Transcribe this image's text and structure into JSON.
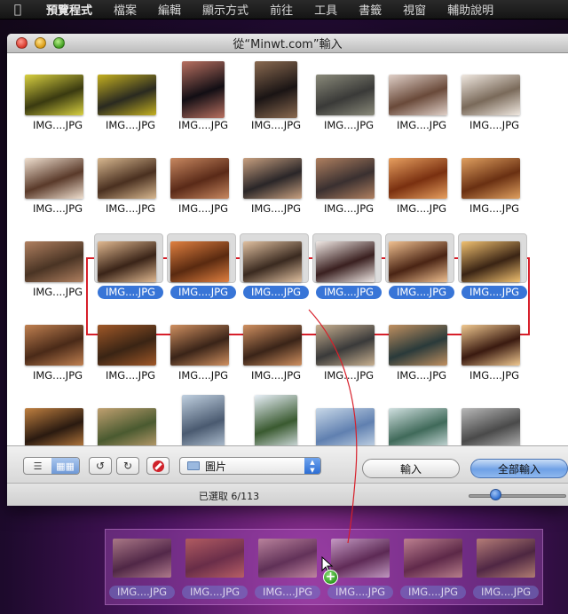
{
  "menubar": {
    "apple": "",
    "items": [
      "預覽程式",
      "檔案",
      "編輯",
      "顯示方式",
      "前往",
      "工具",
      "書籤",
      "視窗",
      "輔助說明"
    ]
  },
  "window": {
    "title": "從“Minwt.com”輸入"
  },
  "thumbnails": {
    "label": "IMG....JPG",
    "rows": [
      {
        "y": 0,
        "colors": [
          [
            "#3a3a10",
            "#d8d040"
          ],
          [
            "#2a2a20",
            "#c4b020"
          ],
          [
            "#120e14",
            "#b87060"
          ],
          [
            "#1a1414",
            "#8a6a50"
          ],
          [
            "#3a3a38",
            "#8a8a7a"
          ],
          [
            "#6a4a3a",
            "#e0d0c8"
          ],
          [
            "#7a6a5a",
            "#f0e8e0"
          ]
        ]
      },
      {
        "y": 1,
        "colors": [
          [
            "#5a3a2a",
            "#f0e0d0"
          ],
          [
            "#4a3020",
            "#d8b890"
          ],
          [
            "#5a2a18",
            "#c88860"
          ],
          [
            "#2a2628",
            "#c8a080"
          ],
          [
            "#3a3030",
            "#b08060"
          ],
          [
            "#7a3010",
            "#e8a060"
          ],
          [
            "#6a3012",
            "#e0a060"
          ]
        ]
      },
      {
        "y": 2,
        "colors": [
          [
            "#4a3424",
            "#b08060"
          ],
          [
            "#3a2418",
            "#e0b890"
          ],
          [
            "#5a2a10",
            "#e08040"
          ],
          [
            "#3a2a20",
            "#e0c0a0"
          ],
          [
            "#3a2020",
            "#f0e8e4"
          ],
          [
            "#4a2414",
            "#f0c090"
          ],
          [
            "#3a2414",
            "#f0c070"
          ]
        ]
      },
      {
        "y": 3,
        "colors": [
          [
            "#4a2a18",
            "#c08050"
          ],
          [
            "#3a2414",
            "#a05828"
          ],
          [
            "#3a2418",
            "#d09060"
          ],
          [
            "#3a2418",
            "#d09060"
          ],
          [
            "#3a3a3a",
            "#c8b090"
          ],
          [
            "#2a3a3a",
            "#c09060"
          ],
          [
            "#3a1a10",
            "#f0c890"
          ]
        ]
      },
      {
        "y": 4,
        "colors": [
          [
            "#2a1a10",
            "#c08040"
          ],
          [
            "#4a5a30",
            "#c0a070"
          ],
          [
            "#4a5a70",
            "#c0d0e0"
          ],
          [
            "#3a5a30",
            "#e8f0f8"
          ],
          [
            "#6080b0",
            "#c8d8e8"
          ],
          [
            "#406a5a",
            "#d0e0e0"
          ],
          [
            "#4a4a4a",
            "#b8b8b8"
          ]
        ]
      }
    ],
    "selected_row": 2,
    "selected_from": 1
  },
  "toolbar": {
    "source_label": "圖片",
    "import_label": "輸入",
    "import_all_label": "全部輸入",
    "list_view_icon": "list-icon",
    "icon_view_icon": "grid-icon"
  },
  "status": {
    "text": "已選取 6/113",
    "zoom_level": 0.25
  },
  "dock": {
    "label": "IMG....JPG",
    "count": 6
  },
  "colors": {
    "selection": "#3875d7",
    "highlight_box": "#d71f2a",
    "drag_line": "#d71f2a"
  }
}
